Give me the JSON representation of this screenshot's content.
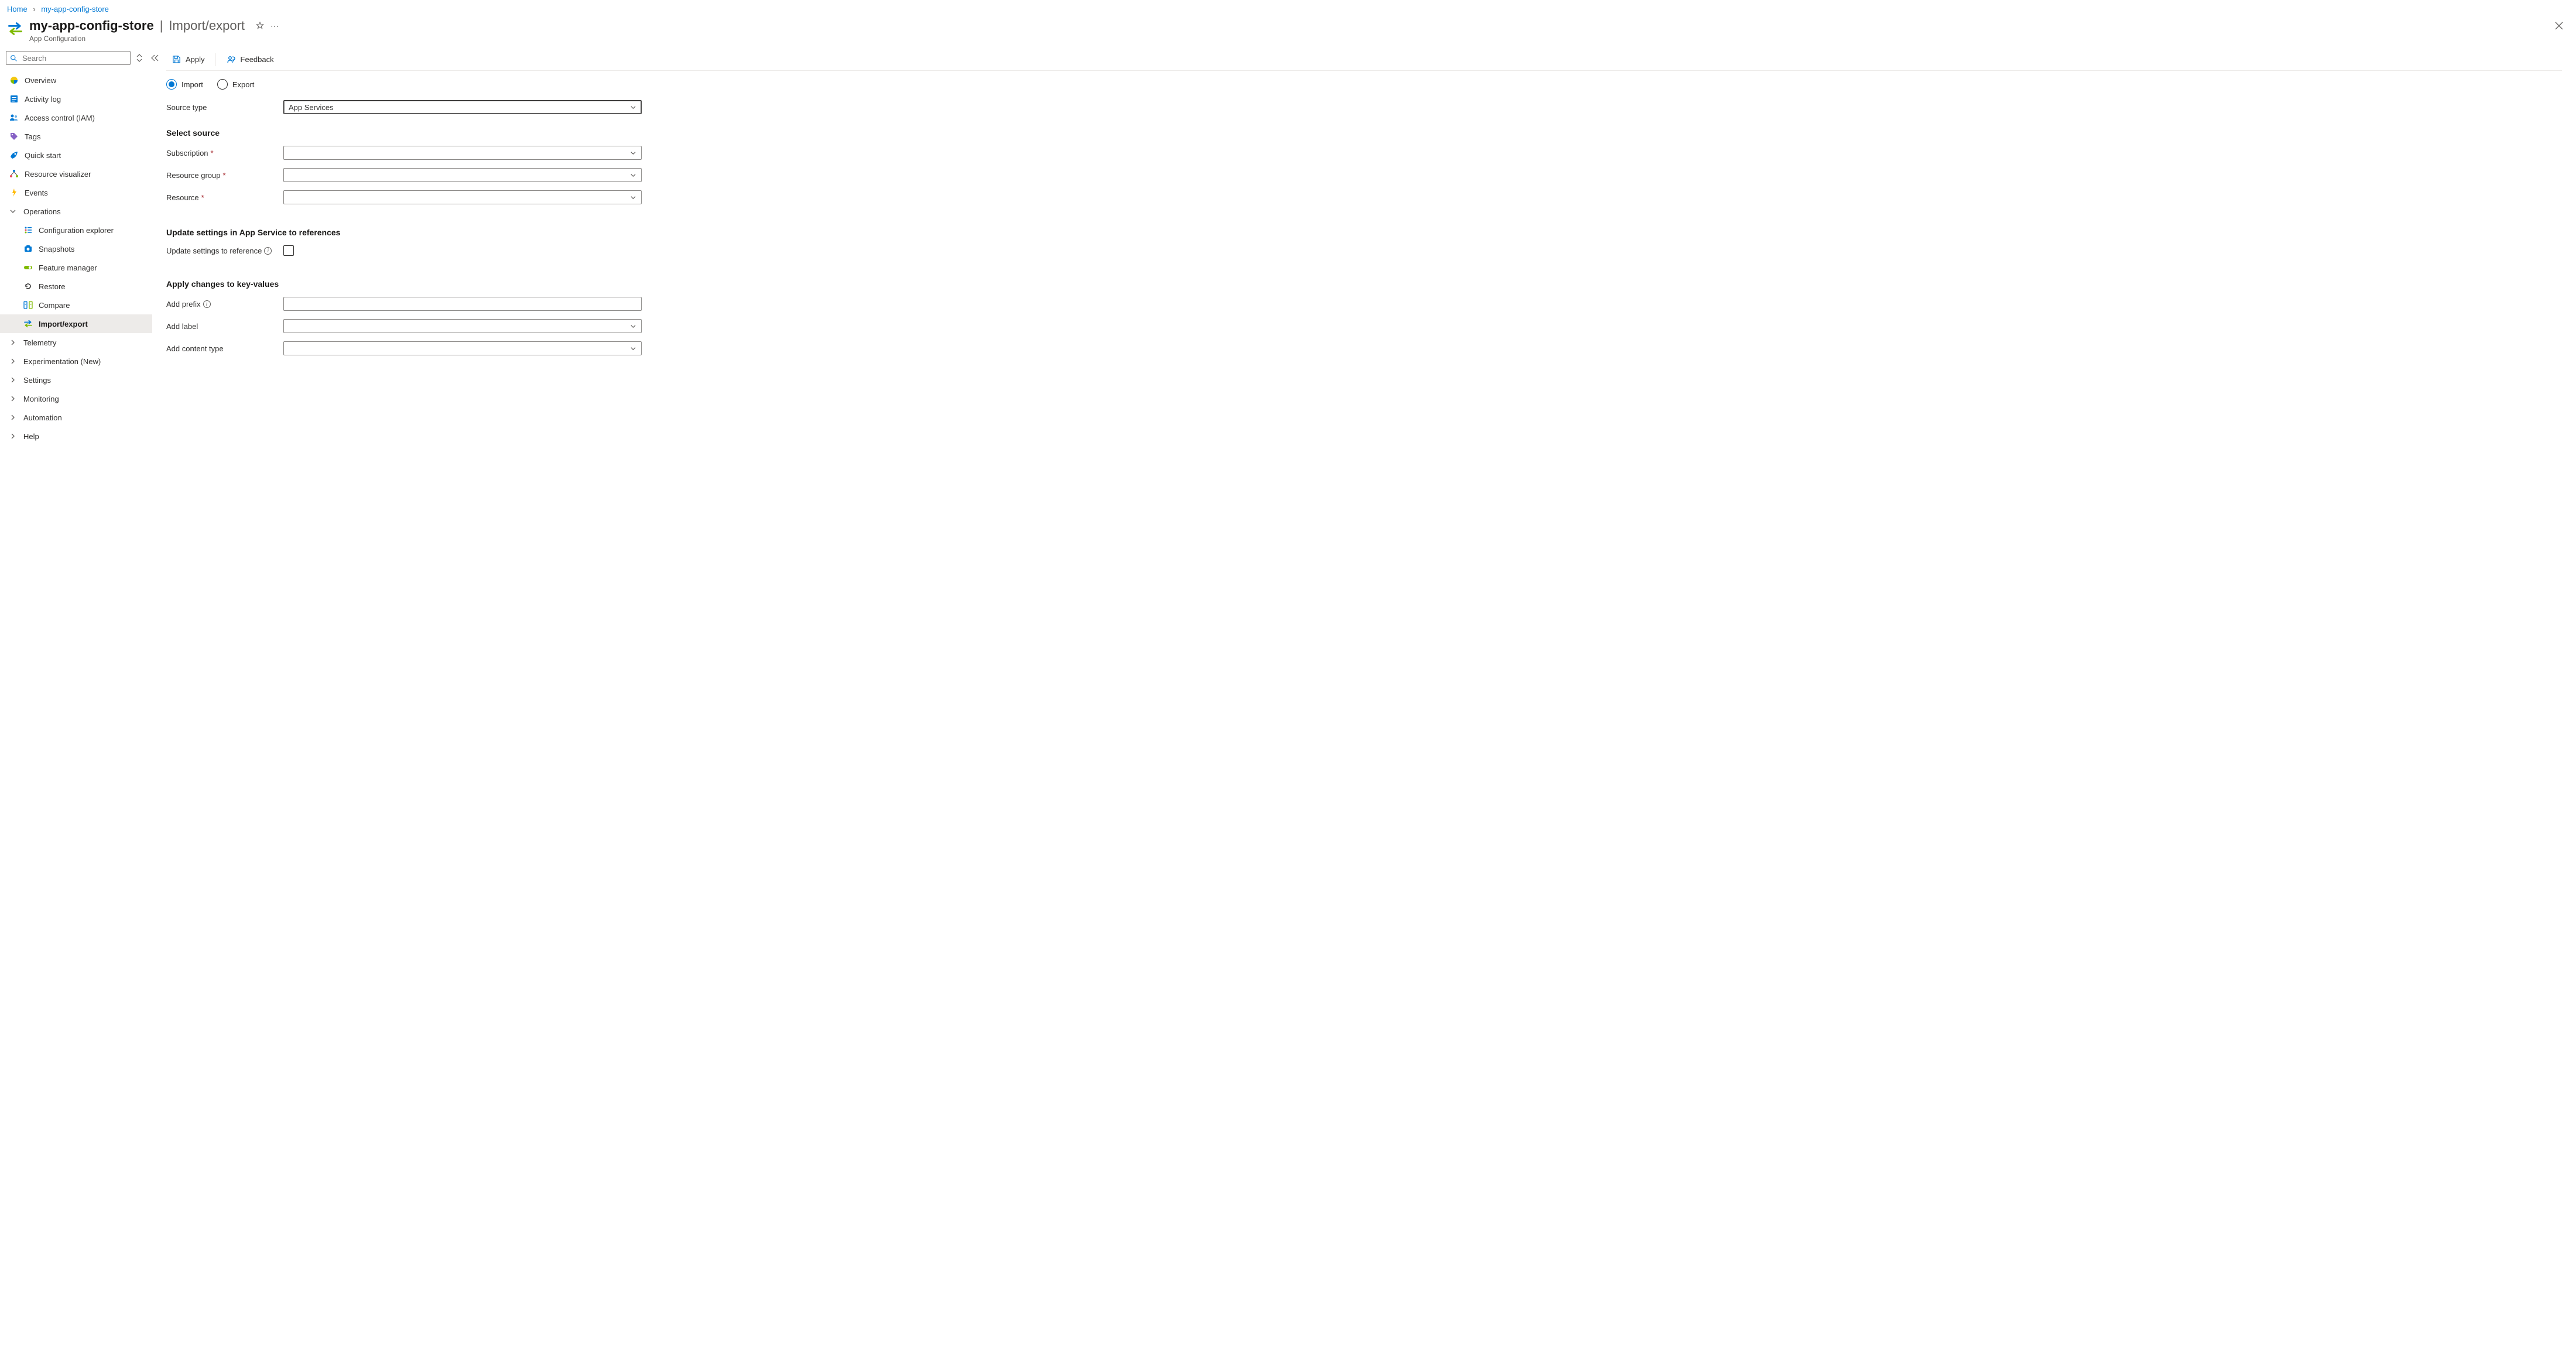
{
  "breadcrumb": {
    "home": "Home",
    "current": "my-app-config-store"
  },
  "header": {
    "title": "my-app-config-store",
    "page": "Import/export",
    "subtitle": "App Configuration"
  },
  "sidebar": {
    "search_placeholder": "Search",
    "items": [
      {
        "label": "Overview"
      },
      {
        "label": "Activity log"
      },
      {
        "label": "Access control (IAM)"
      },
      {
        "label": "Tags"
      },
      {
        "label": "Quick start"
      },
      {
        "label": "Resource visualizer"
      },
      {
        "label": "Events"
      }
    ],
    "operations_label": "Operations",
    "operations": [
      {
        "label": "Configuration explorer"
      },
      {
        "label": "Snapshots"
      },
      {
        "label": "Feature manager"
      },
      {
        "label": "Restore"
      },
      {
        "label": "Compare"
      },
      {
        "label": "Import/export"
      }
    ],
    "groups": [
      {
        "label": "Telemetry"
      },
      {
        "label": "Experimentation (New)"
      },
      {
        "label": "Settings"
      },
      {
        "label": "Monitoring"
      },
      {
        "label": "Automation"
      },
      {
        "label": "Help"
      }
    ]
  },
  "toolbar": {
    "apply": "Apply",
    "feedback": "Feedback"
  },
  "form": {
    "radio_import": "Import",
    "radio_export": "Export",
    "source_type_label": "Source type",
    "source_type_value": "App Services",
    "select_source_heading": "Select source",
    "subscription_label": "Subscription",
    "resource_group_label": "Resource group",
    "resource_label": "Resource",
    "update_heading": "Update settings in App Service to references",
    "update_label": "Update settings to reference",
    "apply_heading": "Apply changes to key-values",
    "add_prefix_label": "Add prefix",
    "add_label_label": "Add label",
    "add_content_type_label": "Add content type"
  }
}
